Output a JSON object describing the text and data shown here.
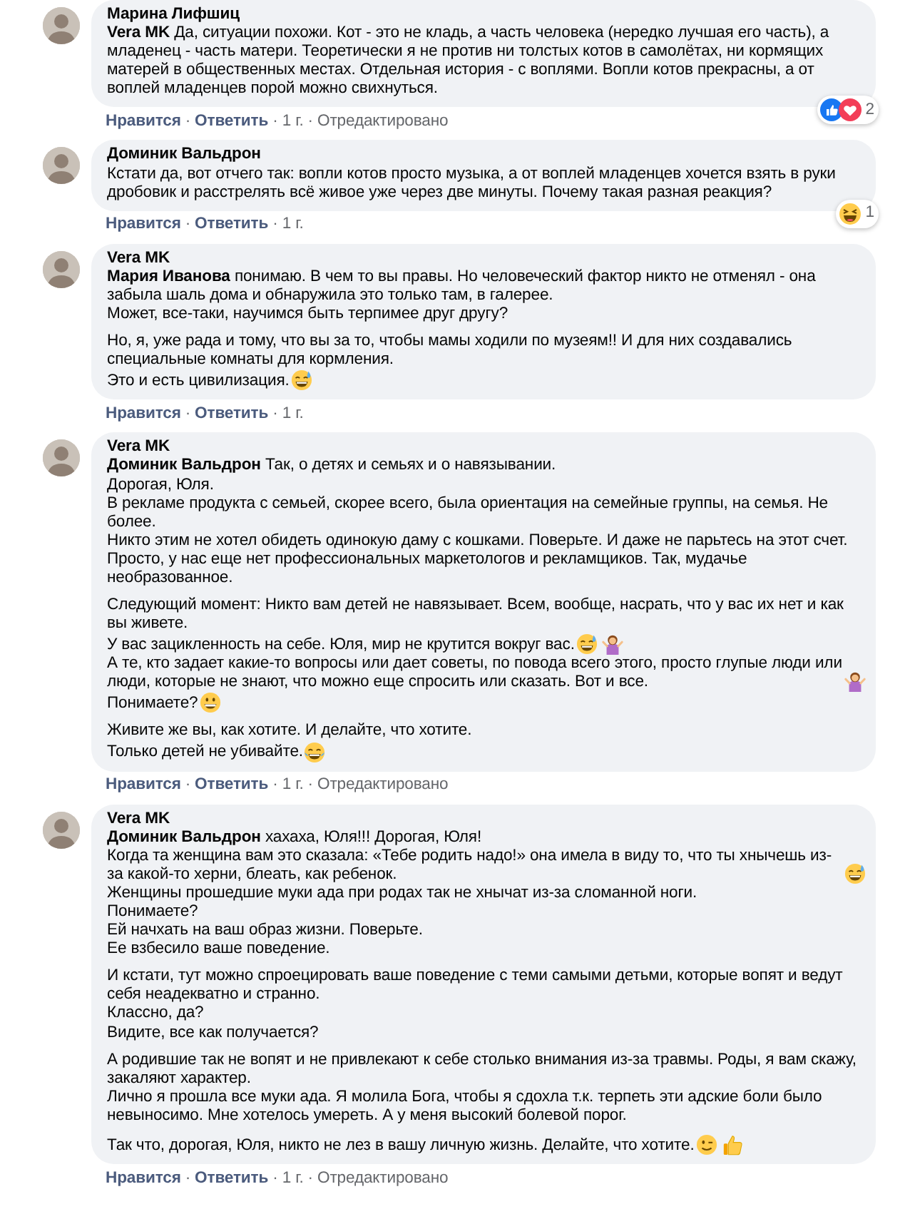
{
  "separator": "·",
  "comments": [
    {
      "author": "Марина Лифшиц",
      "paragraphs": [
        [
          {
            "mention": "Vera MK",
            "text": "Да, ситуации похожи. Кот - это не кладь, а часть человека (нередко лучшая его часть), а младенец - часть матери. Теоретически я не против ни толстых котов в самолётах, ни кормящих матерей в общественных местах. Отдельная история - с воплями. Вопли котов прекрасны, а от воплей младенцев порой можно свихнуться."
          }
        ]
      ],
      "reactions": {
        "icons": [
          {
            "kind": "like"
          },
          {
            "kind": "love"
          }
        ],
        "count": "2"
      },
      "actions": {
        "like": "Нравится",
        "reply": "Ответить",
        "time": "1 г.",
        "edited": "Отредактировано"
      }
    },
    {
      "author": "Доминик Вальдрон",
      "paragraphs": [
        [
          {
            "text": "Кстати да, вот отчего так: вопли котов просто музыка, а от воплей младенцев хочется взять в руки дробовик и расстрелять всё живое уже через две минуты. Почему такая разная реакция?"
          }
        ]
      ],
      "reactions": {
        "icons": [
          {
            "kind": "haha"
          }
        ],
        "count": "1"
      },
      "actions": {
        "like": "Нравится",
        "reply": "Ответить",
        "time": "1 г."
      }
    },
    {
      "author": "Vera MK",
      "paragraphs": [
        [
          {
            "mention": "Мария Иванова",
            "text": "понимаю. В чем то вы правы. Но человеческий фактор никто не отменял - она забыла шаль дома и обнаружила это только там, в галерее."
          },
          {
            "text": "Может, все-таки, научимся быть терпимее друг другу?"
          }
        ],
        [
          {
            "text": "Но, я, уже рада и тому, что вы за то, чтобы мамы ходили по музеям!! И для них создавались специальные комнаты для кормления."
          },
          {
            "text": "Это и есть цивилизация.",
            "emoji": [
              {
                "kind": "grin-sweat"
              }
            ]
          }
        ]
      ],
      "actions": {
        "like": "Нравится",
        "reply": "Ответить",
        "time": "1 г."
      }
    },
    {
      "author": "Vera MK",
      "paragraphs": [
        [
          {
            "mention": "Доминик Вальдрон",
            "text": "Так, о детях и семьях и о навязывании."
          },
          {
            "text": "Дорогая, Юля."
          },
          {
            "text": "В рекламе продукта с семьей, скорее всего, была ориентация на семейные группы, на семья. Не более."
          },
          {
            "text": "Никто этим не хотел обидеть одинокую даму с кошками. Поверьте. И даже не парьтесь на этот счет."
          },
          {
            "text": "Просто, у нас еще нет профессиональных маркетологов и рекламщиков. Так, мудачье необразованное."
          }
        ],
        [
          {
            "text": "Следующий момент: Никто вам детей не навязывает. Всем, вообще, насрать, что у вас их нет и как вы живете."
          },
          {
            "text": "У вас зацикленность на себе. Юля, мир не крутится вокруг вас.",
            "emoji": [
              {
                "kind": "grin-sweat"
              },
              {
                "kind": "shrug"
              }
            ]
          },
          {
            "text": "А те, кто задает какие-то вопросы или дает советы, по повода всего этого, просто глупые люди или люди, которые не знают, что можно еще спросить или сказать. Вот и все.",
            "emoji": [
              {
                "kind": "shrug"
              }
            ]
          },
          {
            "text": "Понимаете?",
            "emoji": [
              {
                "kind": "grin"
              }
            ]
          }
        ],
        [
          {
            "text": "Живите же вы, как хотите. И делайте, что хотите."
          },
          {
            "text": "Только детей не убивайте.",
            "emoji": [
              {
                "kind": "tears-of-joy"
              }
            ]
          }
        ]
      ],
      "actions": {
        "like": "Нравится",
        "reply": "Ответить",
        "time": "1 г.",
        "edited": "Отредактировано"
      }
    },
    {
      "author": "Vera MK",
      "paragraphs": [
        [
          {
            "mention": "Доминик Вальдрон",
            "text": "хахаха, Юля!!! Дорогая, Юля!"
          },
          {
            "text": "Когда та женщина вам это сказала: «Тебе родить надо!» она имела в виду то, что ты хнычешь из-за какой-то херни, блеать, как ребенок.",
            "emoji": [
              {
                "kind": "grin-sweat"
              }
            ]
          },
          {
            "text": "Женщины прошедшие муки ада при родах так не хнычат из-за сломанной ноги."
          },
          {
            "text": "Понимаете?"
          },
          {
            "text": "Ей начхать на ваш образ жизни. Поверьте."
          },
          {
            "text": "Ее взбесило ваше поведение."
          }
        ],
        [
          {
            "text": "И кстати, тут можно спроецировать ваше поведение с теми самыми детьми, которые вопят и ведут себя неадекватно и странно."
          },
          {
            "text": "Классно, да?"
          },
          {
            "text": "Видите, все как получается?"
          }
        ],
        [
          {
            "text": "А родившие так не вопят и не привлекают к себе столько внимания из-за травмы. Роды, я вам скажу, закаляют характер."
          },
          {
            "text": "Лично я прошла все муки ада. Я молила Бога, чтобы я сдохла т.к. терпеть эти адские боли было невыносимо. Мне хотелось умереть. А у меня высокий болевой порог."
          }
        ],
        [
          {
            "text": "Так что, дорогая, Юля, никто не лез в вашу личную жизнь. Делайте, что хотите.",
            "emoji": [
              {
                "kind": "wink"
              },
              {
                "kind": "thumbs-up"
              }
            ]
          }
        ]
      ],
      "actions": {
        "like": "Нравится",
        "reply": "Ответить",
        "time": "1 г.",
        "edited": "Отредактировано"
      }
    }
  ]
}
